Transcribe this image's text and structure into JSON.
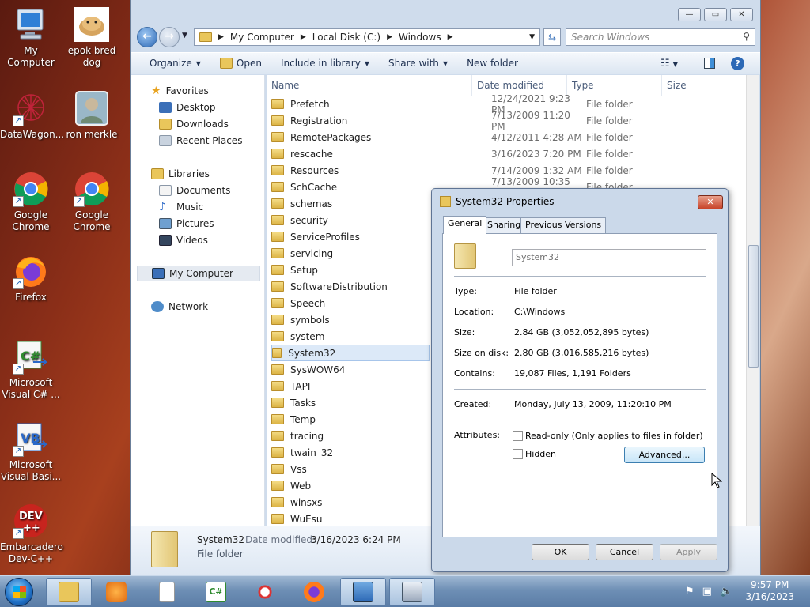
{
  "desktop": {
    "icons": [
      {
        "label": "My Computer"
      },
      {
        "label": "epok bred dog"
      },
      {
        "label": "DataWagon..."
      },
      {
        "label": "ron merkle"
      },
      {
        "label": "Google Chrome"
      },
      {
        "label": "Google Chrome"
      },
      {
        "label": "Firefox"
      },
      {
        "label": "Microsoft Visual C# ..."
      },
      {
        "label": "Microsoft Visual Basi..."
      },
      {
        "label": "Embarcadero Dev-C++"
      }
    ]
  },
  "explorer": {
    "window_controls": {
      "minimize": "—",
      "maximize": "▭",
      "close": "✕"
    },
    "address": {
      "segments": [
        "My Computer",
        "Local Disk (C:)",
        "Windows"
      ]
    },
    "search": {
      "placeholder": "Search Windows"
    },
    "toolbar": {
      "organize": "Organize",
      "open": "Open",
      "include": "Include in library",
      "share": "Share with",
      "new_folder": "New folder"
    },
    "nav": {
      "favorites": "Favorites",
      "desktop": "Desktop",
      "downloads": "Downloads",
      "recent": "Recent Places",
      "libraries": "Libraries",
      "documents": "Documents",
      "music": "Music",
      "pictures": "Pictures",
      "videos": "Videos",
      "my_computer": "My Computer",
      "network": "Network"
    },
    "columns": {
      "name": "Name",
      "date": "Date modified",
      "type": "Type",
      "size": "Size"
    },
    "files": [
      {
        "name": "Prefetch",
        "date": "12/24/2021 9:23 PM",
        "type": "File folder"
      },
      {
        "name": "Registration",
        "date": "7/13/2009 11:20 PM",
        "type": "File folder"
      },
      {
        "name": "RemotePackages",
        "date": "4/12/2011 4:28 AM",
        "type": "File folder"
      },
      {
        "name": "rescache",
        "date": "3/16/2023 7:20 PM",
        "type": "File folder"
      },
      {
        "name": "Resources",
        "date": "7/14/2009 1:32 AM",
        "type": "File folder"
      },
      {
        "name": "SchCache",
        "date": "7/13/2009 10:35 PM",
        "type": "File folder"
      },
      {
        "name": "schemas",
        "date": "",
        "type": ""
      },
      {
        "name": "security",
        "date": "",
        "type": ""
      },
      {
        "name": "ServiceProfiles",
        "date": "",
        "type": ""
      },
      {
        "name": "servicing",
        "date": "",
        "type": ""
      },
      {
        "name": "Setup",
        "date": "",
        "type": ""
      },
      {
        "name": "SoftwareDistribution",
        "date": "",
        "type": ""
      },
      {
        "name": "Speech",
        "date": "",
        "type": ""
      },
      {
        "name": "symbols",
        "date": "",
        "type": ""
      },
      {
        "name": "system",
        "date": "",
        "type": ""
      },
      {
        "name": "System32",
        "date": "",
        "type": ""
      },
      {
        "name": "SysWOW64",
        "date": "",
        "type": ""
      },
      {
        "name": "TAPI",
        "date": "",
        "type": ""
      },
      {
        "name": "Tasks",
        "date": "",
        "type": ""
      },
      {
        "name": "Temp",
        "date": "",
        "type": ""
      },
      {
        "name": "tracing",
        "date": "",
        "type": ""
      },
      {
        "name": "twain_32",
        "date": "",
        "type": ""
      },
      {
        "name": "Vss",
        "date": "",
        "type": ""
      },
      {
        "name": "Web",
        "date": "",
        "type": ""
      },
      {
        "name": "winsxs",
        "date": "",
        "type": ""
      },
      {
        "name": "WuEsu",
        "date": "",
        "type": ""
      }
    ],
    "details": {
      "name": "System32",
      "date_label": "Date modified:",
      "date_value": "3/16/2023 6:24 PM",
      "type": "File folder"
    }
  },
  "properties": {
    "title": "System32 Properties",
    "close": "✕",
    "tabs": [
      "General",
      "Sharing",
      "Previous Versions"
    ],
    "folder_name": "System32",
    "labels": {
      "type": "Type:",
      "location": "Location:",
      "size": "Size:",
      "size_on_disk": "Size on disk:",
      "contains": "Contains:",
      "created": "Created:",
      "attributes": "Attributes:"
    },
    "values": {
      "type": "File folder",
      "location": "C:\\Windows",
      "size": "2.84 GB (3,052,052,895 bytes)",
      "size_on_disk": "2.80 GB (3,016,585,216 bytes)",
      "contains": "19,087 Files, 1,191 Folders",
      "created": "Monday, July 13, 2009, 11:20:10 PM"
    },
    "readonly": "Read-only (Only applies to files in folder)",
    "hidden": "Hidden",
    "advanced": "Advanced...",
    "ok": "OK",
    "cancel": "Cancel",
    "apply": "Apply"
  },
  "taskbar": {
    "time": "9:57 PM",
    "date": "3/16/2023"
  }
}
